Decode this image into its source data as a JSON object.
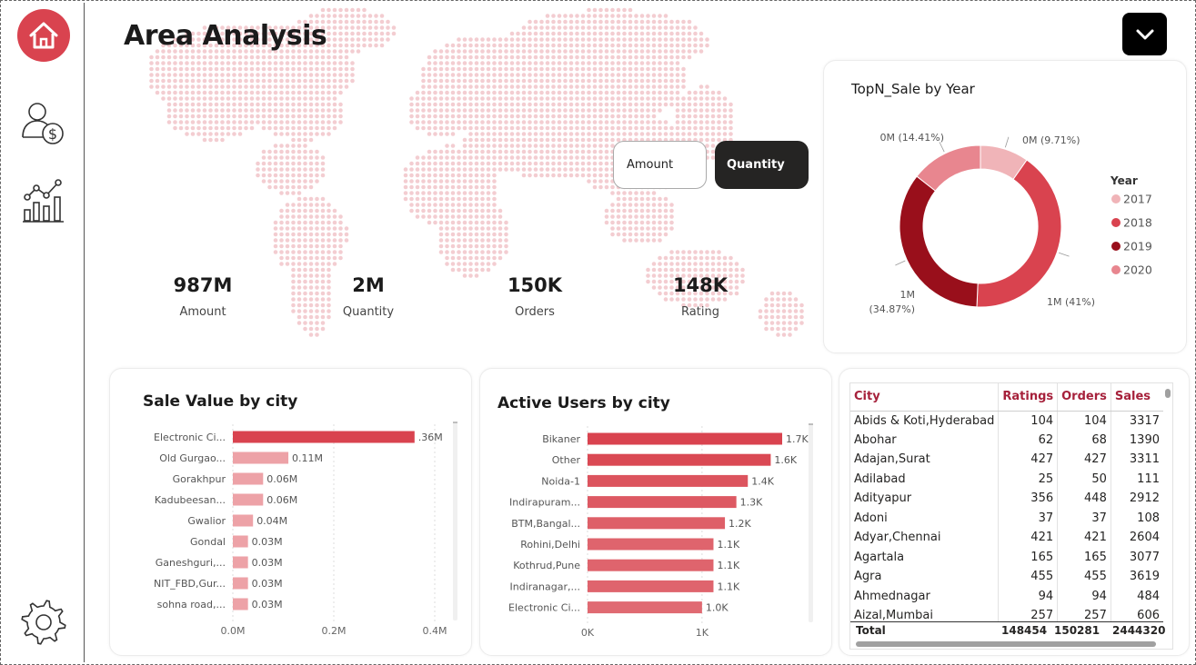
{
  "page": {
    "title": "Area Analysis"
  },
  "toggle": {
    "amount_label": "Amount",
    "quantity_label": "Quantity",
    "selected": "Quantity"
  },
  "kpis": [
    {
      "value": "987M",
      "label": "Amount"
    },
    {
      "value": "2M",
      "label": "Quantity"
    },
    {
      "value": "150K",
      "label": "Orders"
    },
    {
      "value": "148K",
      "label": "Rating"
    }
  ],
  "colors": {
    "accent": "#d9434f",
    "y2017": "#f0b4b8",
    "y2018": "#d9434f",
    "y2019": "#990f1b",
    "y2020": "#e8868f",
    "bar_primary": "#d9434f",
    "bar_light": "#eda2a7",
    "header_red": "#a6213b"
  },
  "chart_data": [
    {
      "type": "pie",
      "title": "TopN_Sale by Year",
      "legend_title": "Year",
      "legend_position": "right",
      "categories": [
        "2017",
        "2018",
        "2019",
        "2020"
      ],
      "values": [
        9.71,
        41,
        34.87,
        14.41
      ],
      "labels": [
        "0M (9.71%)",
        "1M (41%)",
        "1M (34.87%)",
        "0M (14.41%)"
      ]
    },
    {
      "type": "bar",
      "orientation": "horizontal",
      "title": "Sale Value by city",
      "categories": [
        "Electronic Ci...",
        "Old Gurgao...",
        "Gorakhpur",
        "Kadubeesan...",
        "Gwalior",
        "Gondal",
        "Ganeshguri,...",
        "NIT_FBD,Gur...",
        "sohna road,..."
      ],
      "values": [
        0.36,
        0.11,
        0.06,
        0.06,
        0.04,
        0.03,
        0.03,
        0.03,
        0.03
      ],
      "value_labels": [
        ".36M",
        "0.11M",
        "0.06M",
        "0.06M",
        "0.04M",
        "0.03M",
        "0.03M",
        "0.03M",
        "0.03M"
      ],
      "xlim": [
        0,
        0.4
      ],
      "xticks": [
        "0.0M",
        "0.2M",
        "0.4M"
      ]
    },
    {
      "type": "bar",
      "orientation": "horizontal",
      "title": "Active Users by city",
      "categories": [
        "Bikaner",
        "Other",
        "Noida-1",
        "Indirapuram...",
        "BTM,Bangal...",
        "Rohini,Delhi",
        "Kothrud,Pune",
        "Indiranagar,...",
        "Electronic Ci..."
      ],
      "values": [
        1.7,
        1.6,
        1.4,
        1.3,
        1.2,
        1.1,
        1.1,
        1.1,
        1.0
      ],
      "value_labels": [
        "1.7K",
        "1.6K",
        "1.4K",
        "1.3K",
        "1.2K",
        "1.1K",
        "1.1K",
        "1.1K",
        "1.0K"
      ],
      "xlim": [
        0,
        1.7
      ],
      "xticks": [
        "0K",
        "1K"
      ]
    }
  ],
  "table": {
    "columns": [
      "City",
      "Ratings",
      "Orders",
      "Sales"
    ],
    "rows": [
      [
        "Abids & Koti,Hyderabad",
        "104",
        "104",
        "3317"
      ],
      [
        "Abohar",
        "62",
        "68",
        "1390"
      ],
      [
        "Adajan,Surat",
        "427",
        "427",
        "3311"
      ],
      [
        "Adilabad",
        "25",
        "50",
        "111"
      ],
      [
        "Adityapur",
        "356",
        "448",
        "2912"
      ],
      [
        "Adoni",
        "37",
        "37",
        "108"
      ],
      [
        "Adyar,Chennai",
        "421",
        "421",
        "2604"
      ],
      [
        "Agartala",
        "165",
        "165",
        "3077"
      ],
      [
        "Agra",
        "455",
        "455",
        "3619"
      ],
      [
        "Ahmednagar",
        "94",
        "94",
        "484"
      ],
      [
        "Aizal,Mumbai",
        "257",
        "257",
        "606"
      ]
    ],
    "total": {
      "label": "Total",
      "ratings": "148454",
      "orders": "150281",
      "sales": "2444320"
    }
  }
}
